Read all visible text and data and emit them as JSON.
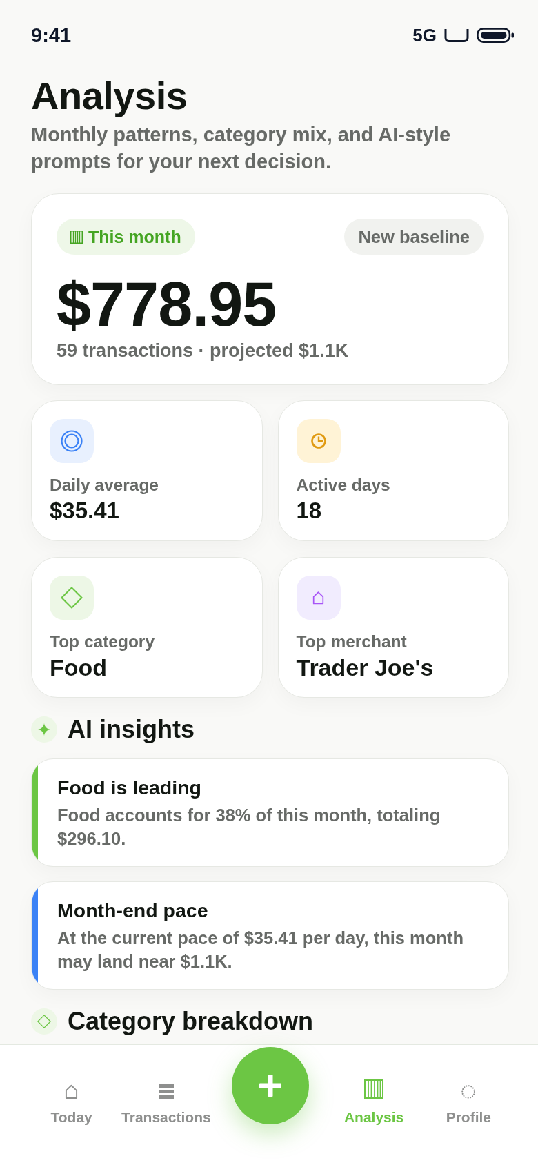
{
  "status_bar": {
    "time": "9:41",
    "network": "5G"
  },
  "header": {
    "title": "Analysis",
    "subtitle": "Monthly patterns, category mix, and AI-style prompts for your next decision."
  },
  "summary": {
    "period": "This month",
    "badge": "New baseline",
    "amount": "$778.95",
    "detail": "59 transactions · projected $1.1K"
  },
  "stats": [
    {
      "label": "Daily average",
      "value": "$35.41"
    },
    {
      "label": "Active days",
      "value": "18"
    },
    {
      "label": "Top category",
      "value": "Food"
    },
    {
      "label": "Top merchant",
      "value": "Trader Joe's"
    }
  ],
  "insights": {
    "title": "AI insights",
    "items": [
      {
        "title": "Food is leading",
        "text": "Food accounts for 38% of this month, totaling $296.10.",
        "color": "#6cc644"
      },
      {
        "title": "Month-end pace",
        "text": "At the current pace of $35.41 per day, this month may land near $1.1K.",
        "color": "#3b82f6"
      }
    ]
  },
  "category_breakdown": {
    "title": "Category breakdown"
  },
  "tab_bar": {
    "items": [
      {
        "label": "Today",
        "selected": false
      },
      {
        "label": "Transactions",
        "selected": false
      },
      {
        "label": "Analysis",
        "selected": true
      },
      {
        "label": "Profile",
        "selected": false
      }
    ]
  }
}
